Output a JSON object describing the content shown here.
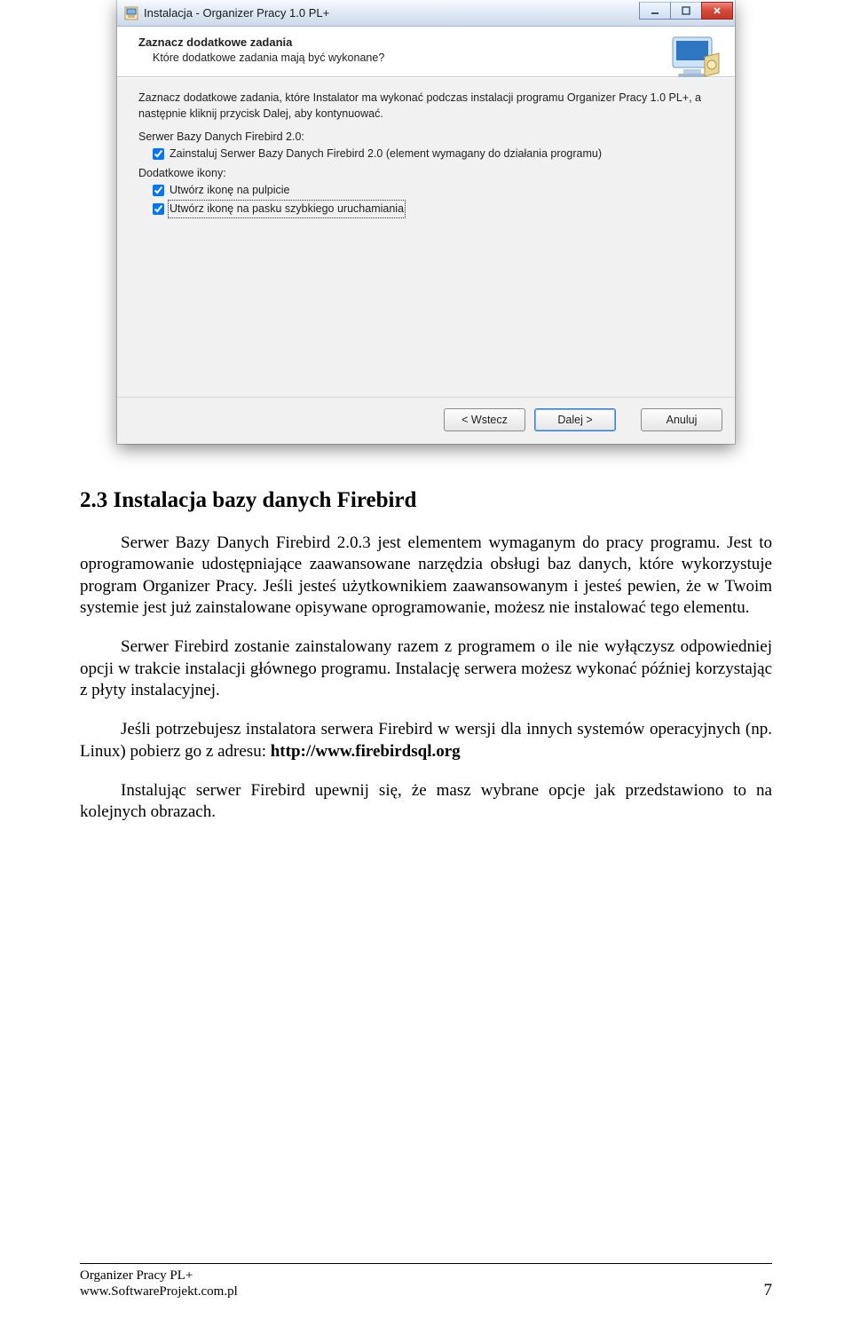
{
  "installer": {
    "window_title": "Instalacja - Organizer Pracy 1.0 PL+",
    "header_title": "Zaznacz dodatkowe zadania",
    "header_sub": "Które dodatkowe zadania mają być wykonane?",
    "body_text": "Zaznacz dodatkowe zadania, które Instalator ma wykonać podczas instalacji programu Organizer Pracy 1.0 PL+, a następnie kliknij przycisk Dalej, aby kontynuować.",
    "group1_label": "Serwer Bazy Danych Firebird 2.0:",
    "check1_label": "Zainstaluj Serwer Bazy Danych Firebird 2.0 (element wymagany do działania programu)",
    "group2_label": "Dodatkowe ikony:",
    "check2_label": "Utwórz ikonę na pulpicie",
    "check3_label": "Utwórz ikonę na pasku szybkiego uruchamiania",
    "btn_back": "< Wstecz",
    "btn_next": "Dalej >",
    "btn_cancel": "Anuluj"
  },
  "doc": {
    "h2": "2.3 Instalacja bazy danych Firebird",
    "p1": "Serwer Bazy Danych Firebird 2.0.3 jest elementem wymaganym do pracy programu. Jest to oprogramowanie udostępniające zaawansowane narzędzia obsługi baz danych, które wykorzystuje program Organizer Pracy. Jeśli jesteś użytkownikiem zaawansowanym i jesteś pewien, że w Twoim systemie jest już zainstalowane opisywane oprogramowanie, możesz nie instalować tego elementu.",
    "p2": "Serwer Firebird zostanie zainstalowany razem z programem o ile nie wyłączysz odpowiedniej opcji w trakcie instalacji głównego programu. Instalację serwera możesz wykonać później korzystając z płyty instalacyjnej.",
    "p3_a": "Jeśli potrzebujesz instalatora serwera Firebird w wersji dla innych systemów operacyjnych (np. Linux) pobierz go z adresu: ",
    "p3_b": "http://www.firebirdsql.org",
    "p4": "Instalując serwer Firebird upewnij się, że masz wybrane opcje jak przedstawiono to na kolejnych obrazach."
  },
  "footer": {
    "line1": "Organizer Pracy PL+",
    "line2": "www.SoftwareProjekt.com.pl",
    "page": "7"
  }
}
